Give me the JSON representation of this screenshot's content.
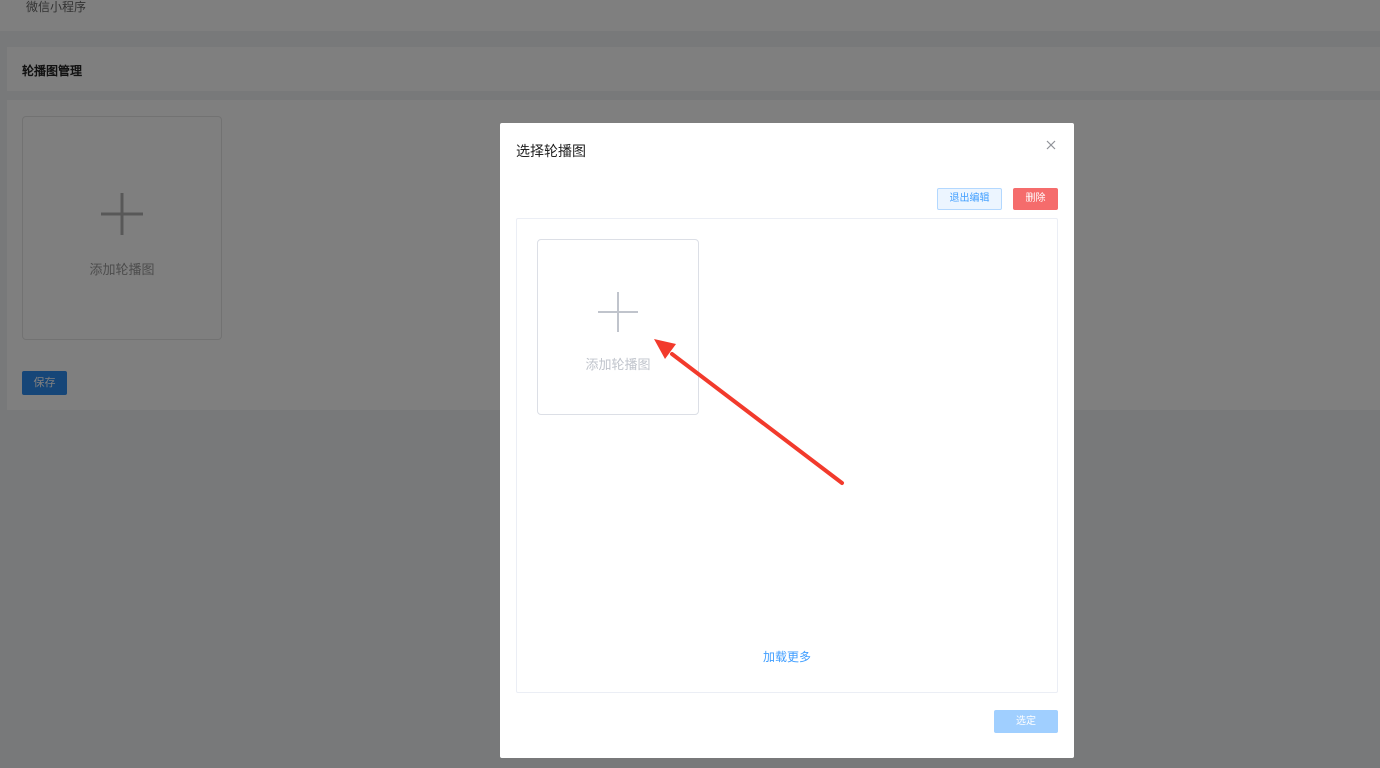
{
  "topbar": {
    "breadcrumb": "微信小程序"
  },
  "section": {
    "title": "轮播图管理"
  },
  "panel": {
    "add_card_label": "添加轮播图",
    "save_label": "保存"
  },
  "dialog": {
    "title": "选择轮播图",
    "exit_edit_label": "退出编辑",
    "delete_label": "删除",
    "add_card_label": "添加轮播图",
    "load_more_label": "加载更多",
    "confirm_label": "选定"
  },
  "colors": {
    "primary": "#409eff",
    "danger": "#f56c6c",
    "confirm_disabled": "#a0cfff",
    "annotation_arrow": "#f23a2c"
  },
  "icons": {
    "close": "close-icon",
    "plus": "plus-icon",
    "annotation": "arrow-annotation"
  }
}
